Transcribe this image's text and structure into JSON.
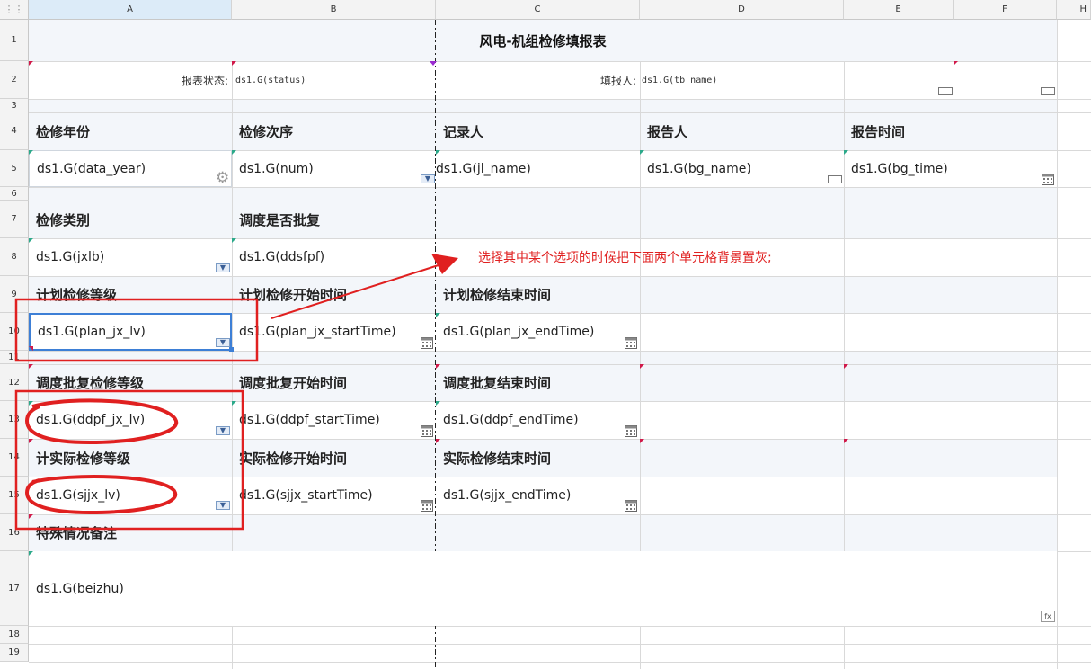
{
  "sheet": {
    "corner_icon": "grid-icon",
    "columns": [
      "A",
      "B",
      "C",
      "D",
      "E",
      "F",
      "H"
    ],
    "rows": [
      "1",
      "2",
      "3",
      "4",
      "5",
      "6",
      "7",
      "8",
      "9",
      "10",
      "11",
      "12",
      "13",
      "14",
      "15",
      "16",
      "17",
      "18",
      "19"
    ],
    "selected_column": "A"
  },
  "report": {
    "title": "风电-机组检修填报表",
    "status_label": "报表状态:",
    "status_value": "ds1.G(status)",
    "filler_label": "填报人:",
    "filler_value": "ds1.G(tb_name)"
  },
  "fields": {
    "r4": [
      "检修年份",
      "检修次序",
      "记录人",
      "报告人",
      "报告时间"
    ],
    "r5": [
      "ds1.G(data_year)",
      "ds1.G(num)",
      "ds1.G(jl_name)",
      "ds1.G(bg_name)",
      "ds1.G(bg_time)"
    ],
    "r7": [
      "检修类别",
      "调度是否批复"
    ],
    "r8": [
      "ds1.G(jxlb)",
      "ds1.G(ddsfpf)"
    ],
    "r9": [
      "计划检修等级",
      "计划检修开始时间",
      "计划检修结束时间"
    ],
    "r10": [
      "ds1.G(plan_jx_lv)",
      "ds1.G(plan_jx_startTime)",
      "ds1.G(plan_jx_endTime)"
    ],
    "r12": [
      "调度批复检修等级",
      "调度批复开始时间",
      "调度批复结束时间"
    ],
    "r13": [
      "ds1.G(ddpf_jx_lv)",
      "ds1.G(ddpf_startTime)",
      "ds1.G(ddpf_endTime)"
    ],
    "r14": [
      "计实际检修等级",
      "实际检修开始时间",
      "实际检修结束时间"
    ],
    "r15": [
      "ds1.G(sjjx_lv)",
      "ds1.G(sjjx_startTime)",
      "ds1.G(sjjx_endTime)"
    ],
    "r16": [
      "特殊情况备注"
    ],
    "r17": [
      "ds1.G(beizhu)"
    ]
  },
  "annotation": {
    "text": "选择其中某个选项的时候把下面两个单元格背景置灰;",
    "color": "#e02020"
  },
  "icons": {
    "dropdown": "dropdown-arrow-icon",
    "calendar": "calendar-icon",
    "gear": "gear-icon",
    "textbox": "textbox-icon",
    "formula": "formula-icon"
  },
  "colors": {
    "header_band": "#f3f6fa",
    "selection": "#3d7fd6",
    "annotation": "#e02020"
  }
}
